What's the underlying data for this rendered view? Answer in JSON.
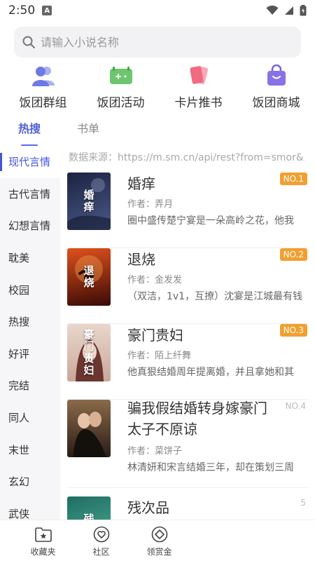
{
  "status_bar": {
    "time": "2:50",
    "notification_badge": "A"
  },
  "search": {
    "placeholder": "请输入小说名称",
    "value": ""
  },
  "quick_nav": [
    {
      "label": "饭团群组",
      "icon": "group-icon",
      "color": "#7a86e8"
    },
    {
      "label": "饭团活动",
      "icon": "activity-ticket-icon",
      "color": "#6cc66e"
    },
    {
      "label": "卡片推书",
      "icon": "cards-icon",
      "color": "#f07a8a"
    },
    {
      "label": "饭团商城",
      "icon": "shopping-bag-icon",
      "color": "#8a72e6"
    }
  ],
  "tabs": [
    {
      "label": "热搜",
      "active": true
    },
    {
      "label": "书单",
      "active": false
    }
  ],
  "categories": [
    {
      "label": "现代言情",
      "active": true
    },
    {
      "label": "古代言情"
    },
    {
      "label": "幻想言情"
    },
    {
      "label": "耽美"
    },
    {
      "label": "校园"
    },
    {
      "label": "热搜"
    },
    {
      "label": "好评"
    },
    {
      "label": "完结"
    },
    {
      "label": "同人"
    },
    {
      "label": "末世"
    },
    {
      "label": "玄幻"
    },
    {
      "label": "武侠"
    }
  ],
  "source_line": "数据来源：https://m.sm.cn/api/rest?from=smor&",
  "books": [
    {
      "title": "婚痒",
      "author": "作者：弄月",
      "desc": "圈中盛传楚宁宴是一朵高岭之花，他我",
      "rank": "NO.1",
      "cover_text": "婚痒",
      "cover_colors": [
        "#1c2340",
        "#4a5a8a"
      ]
    },
    {
      "title": "退烧",
      "author": "作者：金发发",
      "desc": "（双洁，1v1，互撩）沈宴是江城最有钱",
      "rank": "NO.2",
      "cover_text": "退烧",
      "cover_colors": [
        "#3a0a06",
        "#e0511c"
      ]
    },
    {
      "title": "豪门贵妇",
      "author": "作者：陌上纤舞",
      "desc": "他真狠结婚周年提离婚，并且拿她和其",
      "rank": "NO.3",
      "cover_text": "豪门贵妇",
      "cover_colors": [
        "#e9d6cb",
        "#6b3530"
      ]
    },
    {
      "title_lines": [
        "骗我假结婚转身嫁豪门",
        "太子不原谅"
      ],
      "author": "作者：菜饼子",
      "desc": "林清妍和宋言结婚三年，却在策划三周",
      "rank": "NO.4",
      "cover_colors": [
        "#2a1c16",
        "#8a6a4a"
      ]
    },
    {
      "title": "残次品",
      "rank": "5",
      "cover_text": "残次",
      "cover_colors": [
        "#1e6e62",
        "#52b29a"
      ]
    }
  ],
  "bottom_nav": [
    {
      "label": "收藏夹",
      "icon": "favorites-folder-icon"
    },
    {
      "label": "社区",
      "icon": "community-heart-icon"
    },
    {
      "label": "领赏金",
      "icon": "reward-coin-icon"
    }
  ]
}
